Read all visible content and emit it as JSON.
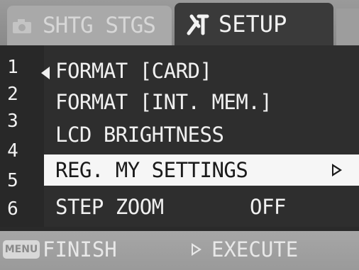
{
  "tabs": [
    {
      "label": "SHTG STGS",
      "icon": "camera-icon",
      "active": false
    },
    {
      "label": "SETUP",
      "icon": "wrench-screwdriver-icon",
      "active": true
    }
  ],
  "menu": {
    "numbers": [
      "1",
      "2",
      "3",
      "4",
      "5",
      "6"
    ],
    "items": [
      {
        "label": "FORMAT [CARD]",
        "value": "",
        "selected": false
      },
      {
        "label": "FORMAT [INT. MEM.]",
        "value": "",
        "selected": false
      },
      {
        "label": "LCD BRIGHTNESS",
        "value": "",
        "selected": false
      },
      {
        "label": "REG. MY SETTINGS",
        "value": "",
        "selected": true,
        "has_arrow": true
      },
      {
        "label": "STEP ZOOM",
        "value": "OFF",
        "selected": false
      }
    ]
  },
  "footer": {
    "menu_button": "MENU",
    "finish_label": "FINISH",
    "execute_label": "EXECUTE"
  },
  "colors": {
    "screen_bg": "#2e2e2e",
    "tab_inactive": "#a9a9a9",
    "tab_active": "#3a3a3a",
    "selected_row": "#f6f6f6",
    "text": "#f0f0f0"
  }
}
